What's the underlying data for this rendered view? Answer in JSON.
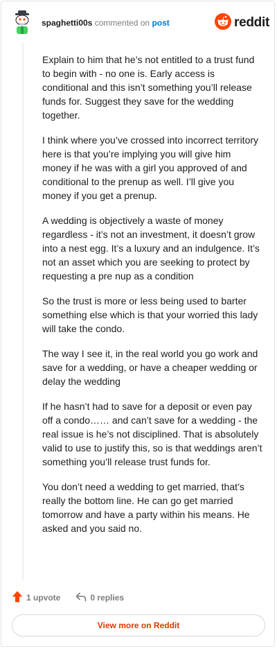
{
  "header": {
    "username": "spaghetti00s",
    "action_text": "commented on",
    "post_link": "post",
    "brand_wordmark": "reddit"
  },
  "icons": {
    "avatar": "snoo-avatar-icon",
    "brand": "reddit-logo-icon",
    "upvote": "upvote-arrow-icon",
    "reply": "reply-arrow-icon"
  },
  "colors": {
    "brand_orange": "#ff4500",
    "link_blue": "#0079d3",
    "view_more_text": "#d93a00",
    "muted_text": "#7c7c7c"
  },
  "comment": {
    "paragraphs": [
      "Explain to him that he’s not entitled to a trust fund to begin with - no one is. Early access is conditional and this isn’t something you’ll release funds for. Suggest they save for the wedding together.",
      "I think where you’ve crossed into incorrect territory here is that you’re implying you will give him money if he was with a girl you approved of and conditional to the prenup as well. I’ll give you money if you get a prenup.",
      "A wedding is objectively a waste of money regardless - it’s not an investment, it doesn’t grow into a nest egg. It’s a luxury and an indulgence. It’s not an asset which you are seeking to protect by requesting a pre nup as a condition",
      "So the trust is more or less being used to barter something else which is that your worried this lady will take the condo.",
      "The way I see it, in the real world you go work and save for a wedding, or have a cheaper wedding or delay the wedding",
      "If he hasn’t had to save for a deposit or even pay off a condo…… and can’t save for a wedding - the real issue is he’s not disciplined. That is absolutely valid to use to justify this, so is that weddings aren’t something you’ll release trust funds for.",
      "You don’t need a wedding to get married, that’s really the bottom line. He can go get married tomorrow and have a party within his means. He asked and you said no."
    ]
  },
  "actions": {
    "upvotes": "1 upvote",
    "replies": "0 replies"
  },
  "footer": {
    "view_more_label": "View more on Reddit"
  }
}
